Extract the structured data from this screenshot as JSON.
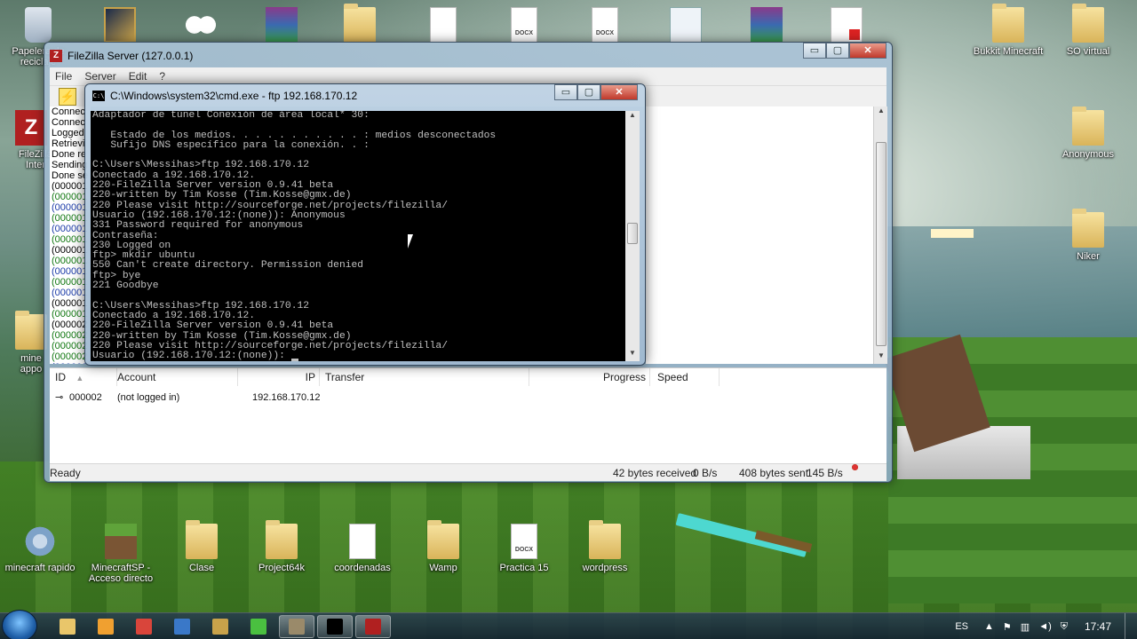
{
  "desktop": {
    "icons_top": [
      {
        "label": "Papelera de reciclaje",
        "icon": "recycle-bin-icon"
      },
      {
        "label": "",
        "icon": "league-of-legends-icon"
      },
      {
        "label": "",
        "icon": "eyes-icon"
      },
      {
        "label": "",
        "icon": "winrar-icon"
      },
      {
        "label": "",
        "icon": "folder-icon"
      },
      {
        "label": "",
        "icon": "document-icon"
      },
      {
        "label": "DOCX",
        "icon": "docx-icon"
      },
      {
        "label": "DOCX",
        "icon": "docx-icon"
      },
      {
        "label": "",
        "icon": "script-icon"
      },
      {
        "label": "",
        "icon": "winrar-icon"
      },
      {
        "label": "",
        "icon": "pdf-icon"
      }
    ],
    "icons_right": [
      {
        "label": "Bukkit Minecraft",
        "icon": "folder-icon"
      },
      {
        "label": "SO virtual",
        "icon": "folder-icon"
      },
      {
        "label": "Anonymous",
        "icon": "folder-icon"
      },
      {
        "label": "Niker",
        "icon": "folder-icon"
      }
    ],
    "icons_left": [
      {
        "label": "FileZilla Inter",
        "icon": "filezilla-icon"
      },
      {
        "label": "mine appo",
        "icon": "folder-icon"
      }
    ],
    "icons_bottom": [
      {
        "label": "minecraft rapido",
        "icon": "gear-icon"
      },
      {
        "label": "MinecraftSP - Acceso directo",
        "icon": "minecraft-icon"
      },
      {
        "label": "Clase",
        "icon": "folder-icon"
      },
      {
        "label": "Project64k",
        "icon": "folder-icon"
      },
      {
        "label": "coordenadas",
        "icon": "text-file-icon"
      },
      {
        "label": "Wamp",
        "icon": "folder-icon"
      },
      {
        "label": "Practica 15",
        "icon": "docx-icon",
        "badge": "DOCX"
      },
      {
        "label": "wordpress",
        "icon": "folder-icon"
      }
    ]
  },
  "filezilla": {
    "title": "FileZilla Server (127.0.0.1)",
    "menu": [
      "File",
      "Server",
      "Edit",
      "?"
    ],
    "window_buttons": {
      "minimize": "▭",
      "maximize": "▢",
      "close": "✕"
    },
    "log_lines": [
      {
        "text": "Connec",
        "color": "black"
      },
      {
        "text": "Connec",
        "color": "black"
      },
      {
        "text": "Logged",
        "color": "black"
      },
      {
        "text": "Retrievi",
        "color": "black"
      },
      {
        "text": "Done re",
        "color": "black"
      },
      {
        "text": "Sending",
        "color": "black"
      },
      {
        "text": "Done se",
        "color": "black"
      },
      {
        "text": "(000001",
        "color": "black"
      },
      {
        "text": "(000001",
        "color": "green"
      },
      {
        "text": "(000001",
        "color": "blue"
      },
      {
        "text": "(000001",
        "color": "green"
      },
      {
        "text": "(000001",
        "color": "blue"
      },
      {
        "text": "(000001",
        "color": "green"
      },
      {
        "text": "(000001",
        "color": "black"
      },
      {
        "text": "(000001",
        "color": "green"
      },
      {
        "text": "(000001",
        "color": "blue"
      },
      {
        "text": "(000001",
        "color": "green"
      },
      {
        "text": "(000001",
        "color": "blue"
      },
      {
        "text": "(000001",
        "color": "black"
      },
      {
        "text": "(000001",
        "color": "green"
      },
      {
        "text": "(000002",
        "color": "black"
      },
      {
        "text": "(000002",
        "color": "green"
      },
      {
        "text": "(000002",
        "color": "green"
      },
      {
        "text": "(000002",
        "color": "green"
      },
      {
        "text": "(000002",
        "color": "blue"
      }
    ],
    "table": {
      "headers": {
        "id": "ID",
        "account": "Account",
        "ip": "IP",
        "transfer": "Transfer",
        "progress": "Progress",
        "speed": "Speed"
      },
      "sort_indicator": "▲",
      "row": {
        "id": "000002",
        "account": "(not logged in)",
        "ip": "192.168.170.12"
      }
    },
    "status": {
      "text": "Ready",
      "received": "42 bytes received",
      "recv_rate": "0 B/s",
      "sent": "408 bytes sent",
      "sent_rate": "145 B/s"
    }
  },
  "cmd": {
    "title": "C:\\Windows\\system32\\cmd.exe - ftp  192.168.170.12",
    "icon_label": "C:\\",
    "lines": [
      "Adaptador de túnel Conexión de área local* 30:",
      "",
      "   Estado de los medios. . . . . . . . . . . : medios desconectados",
      "   Sufijo DNS específico para la conexión. . :",
      "",
      "C:\\Users\\Messihas>ftp 192.168.170.12",
      "Conectado a 192.168.170.12.",
      "220-FileZilla Server version 0.9.41 beta",
      "220-written by Tim Kosse (Tim.Kosse@gmx.de)",
      "220 Please visit http://sourceforge.net/projects/filezilla/",
      "Usuario (192.168.170.12:(none)): Anonymous",
      "331 Password required for anonymous",
      "Contraseña:",
      "230 Logged on",
      "ftp> mkdir ubuntu",
      "550 Can't create directory. Permission denied",
      "ftp> bye",
      "221 Goodbye",
      "",
      "C:\\Users\\Messihas>ftp 192.168.170.12",
      "Conectado a 192.168.170.12.",
      "220-FileZilla Server version 0.9.41 beta",
      "220-written by Tim Kosse (Tim.Kosse@gmx.de)",
      "220 Please visit http://sourceforge.net/projects/filezilla/",
      "Usuario (192.168.170.12:(none)): "
    ]
  },
  "taskbar": {
    "language": "ES",
    "clock": "17:47",
    "items": [
      {
        "name": "explorer",
        "icon": "folder-icon",
        "color": "#e9c66a"
      },
      {
        "name": "media",
        "icon": "media-player-icon",
        "color": "#f0a030"
      },
      {
        "name": "chrome",
        "icon": "chrome-icon",
        "color": "#d9453b"
      },
      {
        "name": "globe",
        "icon": "globe-icon",
        "color": "#3a78c8"
      },
      {
        "name": "lol",
        "icon": "league-of-legends-icon",
        "color": "#c8a24a"
      },
      {
        "name": "messenger",
        "icon": "messenger-icon",
        "color": "#4ac040"
      },
      {
        "name": "tools",
        "icon": "tools-icon",
        "color": "#9a8a6a",
        "active": true
      },
      {
        "name": "cmd",
        "icon": "cmd-icon",
        "color": "#000000",
        "active": true
      },
      {
        "name": "filezilla",
        "icon": "filezilla-icon",
        "color": "#b02020",
        "active": true
      }
    ],
    "tray_icons": [
      "arrow-up-icon",
      "flag-icon",
      "network-icon",
      "volume-icon",
      "shield-icon"
    ]
  }
}
